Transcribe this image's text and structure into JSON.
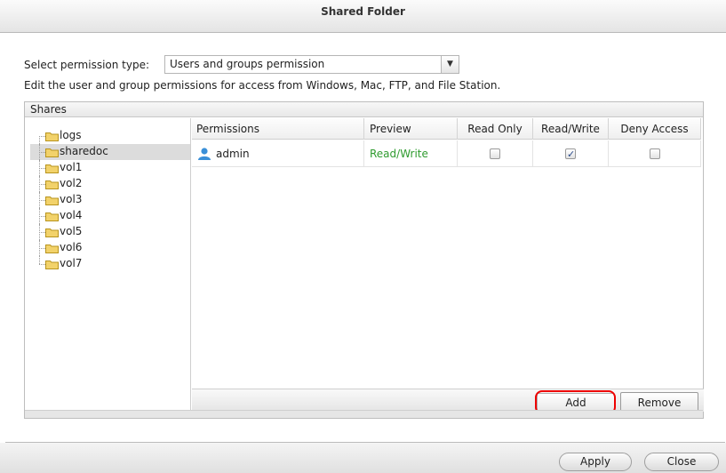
{
  "window": {
    "title": "Shared Folder"
  },
  "permission": {
    "label": "Select permission type:",
    "selected": "Users and groups permission",
    "dropdown_icon": "chevron-down-icon"
  },
  "description": "Edit the user and group permissions for access from Windows, Mac, FTP, and File Station.",
  "shares": {
    "header": "Shares",
    "folders": [
      "logs",
      "sharedoc",
      "vol1",
      "vol2",
      "vol3",
      "vol4",
      "vol5",
      "vol6",
      "vol7"
    ],
    "selected": "sharedoc",
    "folder_icon": "folder-icon",
    "folder_color": "#f2d26a"
  },
  "table": {
    "columns": [
      "Permissions",
      "Preview",
      "Read Only",
      "Read/Write",
      "Deny Access"
    ],
    "rows": [
      {
        "name": "admin",
        "icon": "user-icon",
        "preview": "Read/Write",
        "read_only": false,
        "read_write": true,
        "deny": false
      }
    ],
    "preview_color": "#2f9b2f"
  },
  "buttons": {
    "add": "Add",
    "remove": "Remove",
    "apply": "Apply",
    "close": "Close",
    "highlight_color": "#ee0000"
  }
}
